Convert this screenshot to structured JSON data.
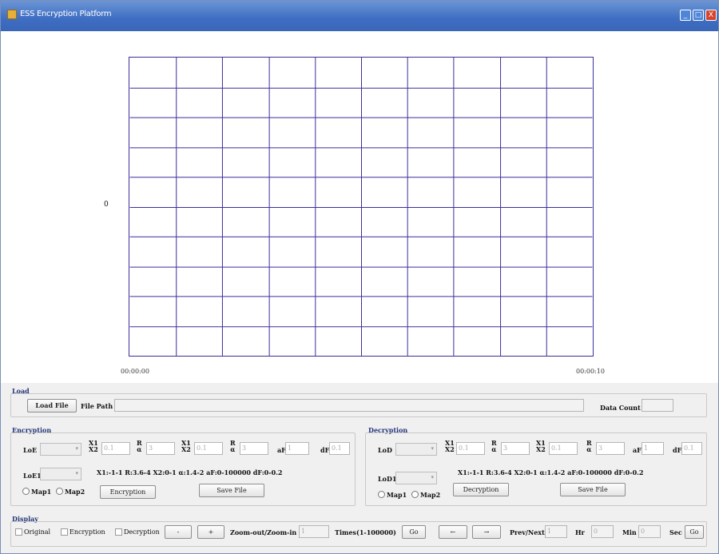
{
  "window": {
    "title": "ESS Encryption Platform",
    "minimize": "_",
    "maximize": "□",
    "close": "X"
  },
  "plot": {
    "y_label": "0",
    "x_start": "00:00:00",
    "x_end": "00:00:10",
    "rows": 10,
    "cols": 10
  },
  "load": {
    "title": "Load",
    "load_button": "Load File",
    "file_path_label": "File Path",
    "file_path_value": "",
    "data_count_label": "Data Count",
    "data_count_value": ""
  },
  "encryption": {
    "title": "Encryption",
    "lo_label": "LoE",
    "lo1_label": "LoE1",
    "x1x2_a_top": "X1",
    "x1x2_a_bot": "X2",
    "x1x2_a_value": "0.1",
    "ra_a_top": "R",
    "ra_a_bot": "α",
    "ra_a_value": "3",
    "x1x2_b_top": "X1",
    "x1x2_b_bot": "X2",
    "x1x2_b_value": "0.1",
    "ra_b_top": "R",
    "ra_b_bot": "α",
    "ra_b_value": "3",
    "af_label": "aF",
    "af_value": "1",
    "df_label": "dF",
    "df_value": "0.1",
    "ranges": "X1:-1-1  R:3.6-4  X2:0-1  α:1.4-2   aF:0-100000   dF:0-0.2",
    "map1": "Map1",
    "map2": "Map2",
    "encrypt_button": "Encryption",
    "save_button": "Save File"
  },
  "decryption": {
    "title": "Decryption",
    "lo_label": "LoD",
    "lo1_label": "LoD1",
    "x1x2_a_top": "X1",
    "x1x2_a_bot": "X2",
    "x1x2_a_value": "0.1",
    "ra_a_top": "R",
    "ra_a_bot": "α",
    "ra_a_value": "3",
    "x1x2_b_top": "X1",
    "x1x2_b_bot": "X2",
    "x1x2_b_value": "0.1",
    "ra_b_top": "R",
    "ra_b_bot": "α",
    "ra_b_value": "3",
    "af_label": "aF",
    "af_value": "1",
    "df_label": "dF",
    "df_value": "0.1",
    "ranges": "X1:-1-1  R:3.6-4  X2:0-1  α:1.4-2   aF:0-100000   dF:0-0.2",
    "map1": "Map1",
    "map2": "Map2",
    "decrypt_button": "Decryption",
    "save_button": "Save File"
  },
  "display": {
    "title": "Display",
    "original": "Original",
    "encryption": "Encryption",
    "decryption": "Decryption",
    "minus": "-",
    "plus": "+",
    "zoom_label": "Zoom-out/Zoom-in",
    "zoom_value": "1",
    "times_label": "Times(1-100000)",
    "go1": "Go",
    "left_arrow": "←",
    "right_arrow": "→",
    "prevnext_label": "Prev/Next",
    "prevnext_value": "1",
    "hr_label": "Hr",
    "hr_value": "0",
    "min_label": "Min",
    "min_value": "0",
    "sec_label": "Sec",
    "go2": "Go"
  }
}
